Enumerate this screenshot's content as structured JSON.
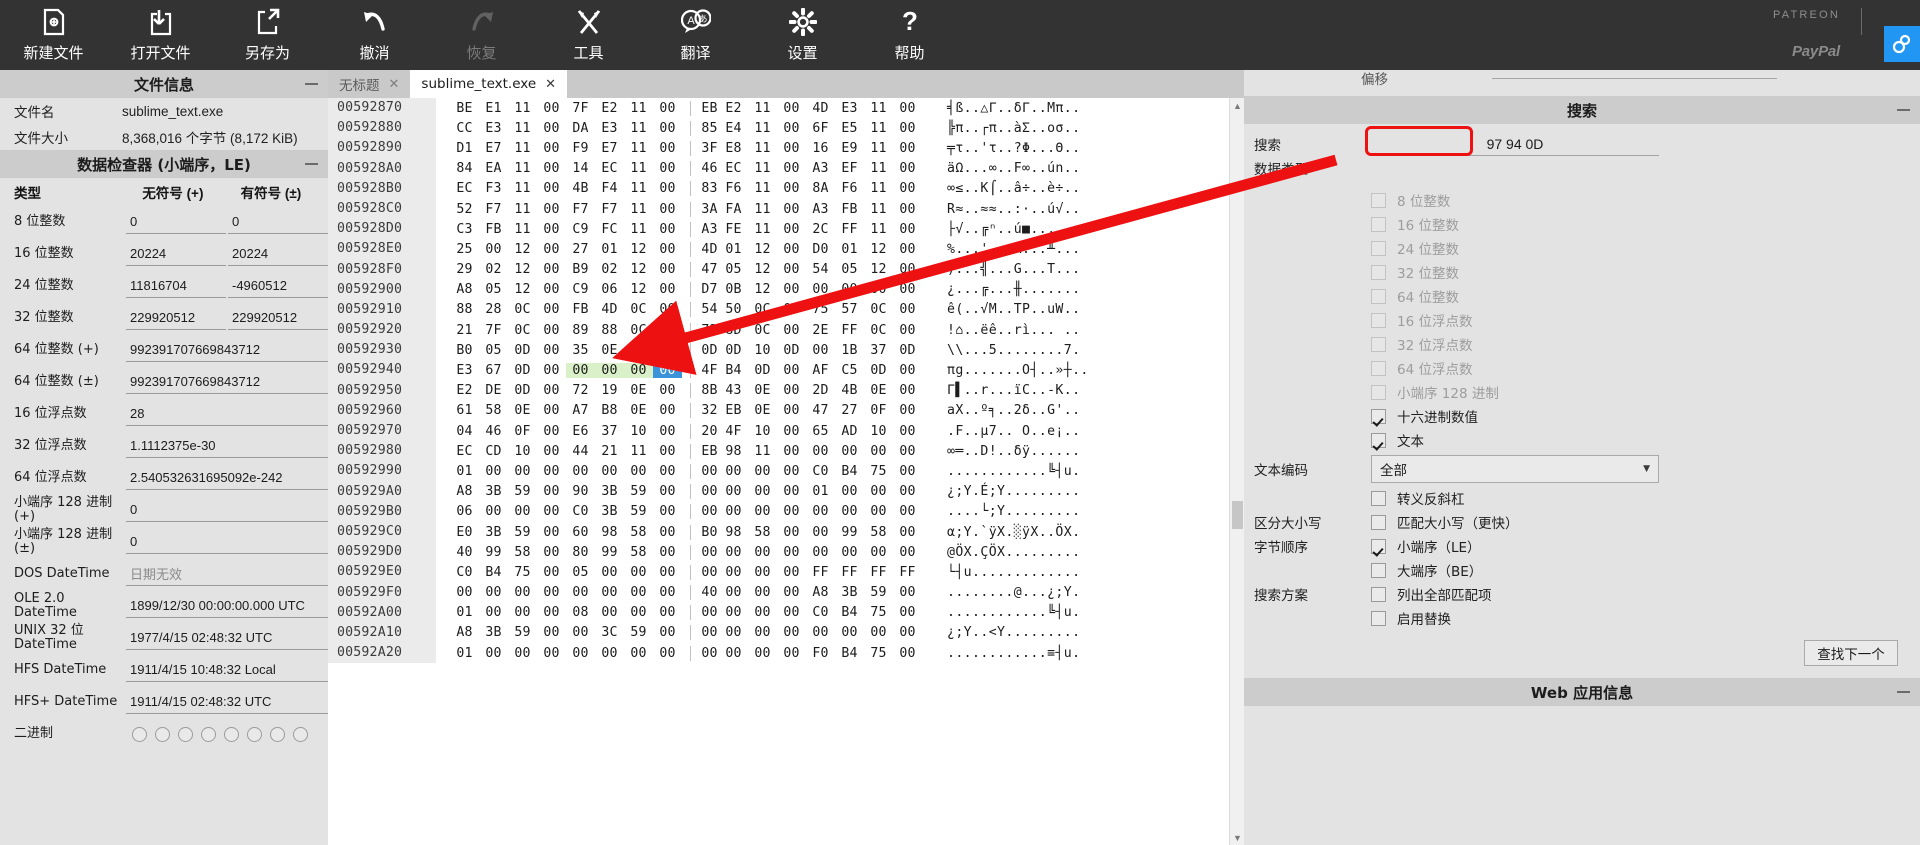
{
  "toolbar": {
    "buttons": [
      {
        "label": "新建文件",
        "icon": "new-file-icon",
        "disabled": false
      },
      {
        "label": "打开文件",
        "icon": "open-file-icon",
        "disabled": false
      },
      {
        "label": "另存为",
        "icon": "save-as-icon",
        "disabled": false
      },
      {
        "label": "撤消",
        "icon": "undo-icon",
        "disabled": false
      },
      {
        "label": "恢复",
        "icon": "redo-icon",
        "disabled": true
      },
      {
        "label": "工具",
        "icon": "tools-icon",
        "disabled": false
      },
      {
        "label": "翻译",
        "icon": "translate-icon",
        "disabled": false
      },
      {
        "label": "设置",
        "icon": "settings-icon",
        "disabled": false
      },
      {
        "label": "帮助",
        "icon": "help-icon",
        "disabled": false
      }
    ],
    "brand_patreon": "PATREON",
    "brand_paypal": "PayPal"
  },
  "sidebar": {
    "file_info": {
      "title": "文件信息",
      "rows": [
        {
          "key": "文件名",
          "value": "sublime_text.exe"
        },
        {
          "key": "文件大小",
          "value": "8,368,016 个字节 (8,172 KiB)"
        }
      ]
    },
    "data_inspector": {
      "title": "数据检查器 (小端序，LE)",
      "headers": {
        "type": "类型",
        "unsigned": "无符号 (+)",
        "signed": "有符号 (±)"
      },
      "rows": [
        {
          "label": "8 位整数",
          "unsigned": "0",
          "signed": "0",
          "wide": false,
          "grey": false
        },
        {
          "label": "16 位整数",
          "unsigned": "20224",
          "signed": "20224",
          "wide": false,
          "grey": false
        },
        {
          "label": "24 位整数",
          "unsigned": "11816704",
          "signed": "-4960512",
          "wide": false,
          "grey": false
        },
        {
          "label": "32 位整数",
          "unsigned": "229920512",
          "signed": "229920512",
          "wide": false,
          "grey": false
        },
        {
          "label": "64 位整数 (+)",
          "unsigned": "992391707669843712",
          "signed": "",
          "wide": true,
          "grey": false
        },
        {
          "label": "64 位整数 (±)",
          "unsigned": "992391707669843712",
          "signed": "",
          "wide": true,
          "grey": false
        },
        {
          "label": "16 位浮点数",
          "unsigned": "28",
          "signed": "",
          "wide": true,
          "grey": false
        },
        {
          "label": "32 位浮点数",
          "unsigned": "1.1112375e-30",
          "signed": "",
          "wide": true,
          "grey": false
        },
        {
          "label": "64 位浮点数",
          "unsigned": "2.540532631695092e-242",
          "signed": "",
          "wide": true,
          "grey": false
        },
        {
          "label": "小端序 128 进制 (+)",
          "unsigned": "0",
          "signed": "",
          "wide": true,
          "grey": false
        },
        {
          "label": "小端序 128 进制 (±)",
          "unsigned": "0",
          "signed": "",
          "wide": true,
          "grey": false
        },
        {
          "label": "DOS DateTime",
          "unsigned": "日期无效",
          "signed": "",
          "wide": true,
          "grey": true
        },
        {
          "label": "OLE 2.0 DateTime",
          "unsigned": "1899/12/30 00:00:00.000 UTC",
          "signed": "",
          "wide": true,
          "grey": false
        },
        {
          "label": "UNIX 32 位 DateTime",
          "unsigned": "1977/4/15 02:48:32 UTC",
          "signed": "",
          "wide": true,
          "grey": false
        },
        {
          "label": "HFS DateTime",
          "unsigned": "1911/4/15 10:48:32 Local",
          "signed": "",
          "wide": true,
          "grey": false
        },
        {
          "label": "HFS+ DateTime",
          "unsigned": "1911/4/15 02:48:32 UTC",
          "signed": "",
          "wide": true,
          "grey": false
        }
      ],
      "binary_label": "二进制",
      "binary_bits": 8
    }
  },
  "editor": {
    "tabs": [
      {
        "label": "无标题",
        "active": false,
        "close": "✕"
      },
      {
        "label": "sublime_text.exe",
        "active": true,
        "close": "✕"
      }
    ],
    "rows": [
      {
        "addr": "00592870",
        "bytes": [
          "BE",
          "E1",
          "11",
          "00",
          "7F",
          "E2",
          "11",
          "00",
          "EB",
          "E2",
          "11",
          "00",
          "4D",
          "E3",
          "11",
          "00"
        ],
        "ascii": "╡ß..△Γ..δΓ..Mπ.."
      },
      {
        "addr": "00592880",
        "bytes": [
          "CC",
          "E3",
          "11",
          "00",
          "DA",
          "E3",
          "11",
          "00",
          "85",
          "E4",
          "11",
          "00",
          "6F",
          "E5",
          "11",
          "00"
        ],
        "ascii": "╠π..┌π..àΣ..oσ.."
      },
      {
        "addr": "00592890",
        "bytes": [
          "D1",
          "E7",
          "11",
          "00",
          "F9",
          "E7",
          "11",
          "00",
          "3F",
          "E8",
          "11",
          "00",
          "16",
          "E9",
          "11",
          "00"
        ],
        "ascii": "╤τ..'τ..?Φ...Θ.."
      },
      {
        "addr": "005928A0",
        "bytes": [
          "84",
          "EA",
          "11",
          "00",
          "14",
          "EC",
          "11",
          "00",
          "46",
          "EC",
          "11",
          "00",
          "A3",
          "EF",
          "11",
          "00"
        ],
        "ascii": "äΩ...∞..F∞..ún.."
      },
      {
        "addr": "005928B0",
        "bytes": [
          "EC",
          "F3",
          "11",
          "00",
          "4B",
          "F4",
          "11",
          "00",
          "83",
          "F6",
          "11",
          "00",
          "8A",
          "F6",
          "11",
          "00"
        ],
        "ascii": "∞≤..K⌠..â÷..è÷.."
      },
      {
        "addr": "005928C0",
        "bytes": [
          "52",
          "F7",
          "11",
          "00",
          "F7",
          "F7",
          "11",
          "00",
          "3A",
          "FA",
          "11",
          "00",
          "A3",
          "FB",
          "11",
          "00"
        ],
        "ascii": "R≈..≈≈..:·..ú√.."
      },
      {
        "addr": "005928D0",
        "bytes": [
          "C3",
          "FB",
          "11",
          "00",
          "C9",
          "FC",
          "11",
          "00",
          "A3",
          "FE",
          "11",
          "00",
          "2C",
          "FF",
          "11",
          "00"
        ],
        "ascii": "├√..╔ⁿ..ú■..,  ."
      },
      {
        "addr": "005928E0",
        "bytes": [
          "25",
          "00",
          "12",
          "00",
          "27",
          "01",
          "12",
          "00",
          "4D",
          "01",
          "12",
          "00",
          "D0",
          "01",
          "12",
          "00"
        ],
        "ascii": "%...'...M...╨..."
      },
      {
        "addr": "005928F0",
        "bytes": [
          "29",
          "02",
          "12",
          "00",
          "B9",
          "02",
          "12",
          "00",
          "47",
          "05",
          "12",
          "00",
          "54",
          "05",
          "12",
          "00"
        ],
        "ascii": ")...╣...G...T..."
      },
      {
        "addr": "00592900",
        "bytes": [
          "A8",
          "05",
          "12",
          "00",
          "C9",
          "06",
          "12",
          "00",
          "D7",
          "0B",
          "12",
          "00",
          "00",
          "00",
          "00",
          "00"
        ],
        "ascii": "¿...╔...╫......."
      },
      {
        "addr": "00592910",
        "bytes": [
          "88",
          "28",
          "0C",
          "00",
          "FB",
          "4D",
          "0C",
          "00",
          "54",
          "50",
          "0C",
          "00",
          "75",
          "57",
          "0C",
          "00"
        ],
        "ascii": "ê(..√M..TP..uW.."
      },
      {
        "addr": "00592920",
        "bytes": [
          "21",
          "7F",
          "0C",
          "00",
          "89",
          "88",
          "0C",
          "00",
          "72",
          "8D",
          "0C",
          "00",
          "2E",
          "FF",
          "0C",
          "00"
        ],
        "ascii": "!⌂..ëê..rì... .."
      },
      {
        "addr": "00592930",
        "bytes": [
          "B0",
          "05",
          "0D",
          "00",
          "35",
          "0E",
          "0D",
          "00",
          "0D",
          "0D",
          "10",
          "0D",
          "00",
          "1B",
          "37",
          "0D"
        ],
        "ascii": "\\\\...5........7."
      },
      {
        "addr": "00592940",
        "bytes": [
          "E3",
          "67",
          "0D",
          "00",
          "00",
          "00",
          "00",
          "00",
          "4F",
          "B4",
          "0D",
          "00",
          "AF",
          "C5",
          "0D",
          "00"
        ],
        "ascii": "πg.......O┤..»┼..",
        "highlight": [
          4,
          5,
          6
        ],
        "selected": 7
      },
      {
        "addr": "00592950",
        "bytes": [
          "E2",
          "DE",
          "0D",
          "00",
          "72",
          "19",
          "0E",
          "00",
          "8B",
          "43",
          "0E",
          "00",
          "2D",
          "4B",
          "0E",
          "00"
        ],
        "ascii": "Γ▌..r...ïC..-K.."
      },
      {
        "addr": "00592960",
        "bytes": [
          "61",
          "58",
          "0E",
          "00",
          "A7",
          "B8",
          "0E",
          "00",
          "32",
          "EB",
          "0E",
          "00",
          "47",
          "27",
          "0F",
          "00"
        ],
        "ascii": "aX..º╕..2δ..G'.."
      },
      {
        "addr": "00592970",
        "bytes": [
          "04",
          "46",
          "0F",
          "00",
          "E6",
          "37",
          "10",
          "00",
          "20",
          "4F",
          "10",
          "00",
          "65",
          "AD",
          "10",
          "00"
        ],
        "ascii": ".F..µ7.. O..e¡.."
      },
      {
        "addr": "00592980",
        "bytes": [
          "EC",
          "CD",
          "10",
          "00",
          "44",
          "21",
          "11",
          "00",
          "EB",
          "98",
          "11",
          "00",
          "00",
          "00",
          "00",
          "00"
        ],
        "ascii": "∞═..D!..δÿ......"
      },
      {
        "addr": "00592990",
        "bytes": [
          "01",
          "00",
          "00",
          "00",
          "00",
          "00",
          "00",
          "00",
          "00",
          "00",
          "00",
          "00",
          "C0",
          "B4",
          "75",
          "00"
        ],
        "ascii": "............╚┤u."
      },
      {
        "addr": "005929A0",
        "bytes": [
          "A8",
          "3B",
          "59",
          "00",
          "90",
          "3B",
          "59",
          "00",
          "00",
          "00",
          "00",
          "00",
          "01",
          "00",
          "00",
          "00"
        ],
        "ascii": "¿;Y.É;Y........."
      },
      {
        "addr": "005929B0",
        "bytes": [
          "06",
          "00",
          "00",
          "00",
          "C0",
          "3B",
          "59",
          "00",
          "00",
          "00",
          "00",
          "00",
          "00",
          "00",
          "00",
          "00"
        ],
        "ascii": "....└;Y........."
      },
      {
        "addr": "005929C0",
        "bytes": [
          "E0",
          "3B",
          "59",
          "00",
          "60",
          "98",
          "58",
          "00",
          "B0",
          "98",
          "58",
          "00",
          "00",
          "99",
          "58",
          "00"
        ],
        "ascii": "α;Y.`ÿX.░ÿX..ÖX."
      },
      {
        "addr": "005929D0",
        "bytes": [
          "40",
          "99",
          "58",
          "00",
          "80",
          "99",
          "58",
          "00",
          "00",
          "00",
          "00",
          "00",
          "00",
          "00",
          "00",
          "00"
        ],
        "ascii": "@ÖX.ÇÖX........."
      },
      {
        "addr": "005929E0",
        "bytes": [
          "C0",
          "B4",
          "75",
          "00",
          "05",
          "00",
          "00",
          "00",
          "00",
          "00",
          "00",
          "00",
          "FF",
          "FF",
          "FF",
          "FF"
        ],
        "ascii": "└┤u............."
      },
      {
        "addr": "005929F0",
        "bytes": [
          "00",
          "00",
          "00",
          "00",
          "00",
          "00",
          "00",
          "00",
          "40",
          "00",
          "00",
          "00",
          "A8",
          "3B",
          "59",
          "00"
        ],
        "ascii": "........@...¿;Y."
      },
      {
        "addr": "00592A00",
        "bytes": [
          "01",
          "00",
          "00",
          "00",
          "08",
          "00",
          "00",
          "00",
          "00",
          "00",
          "00",
          "00",
          "C0",
          "B4",
          "75",
          "00"
        ],
        "ascii": "............╚┤u."
      },
      {
        "addr": "00592A10",
        "bytes": [
          "A8",
          "3B",
          "59",
          "00",
          "00",
          "3C",
          "59",
          "00",
          "00",
          "00",
          "00",
          "00",
          "00",
          "00",
          "00",
          "00"
        ],
        "ascii": "¿;Y..<Y........."
      },
      {
        "addr": "00592A20",
        "bytes": [
          "01",
          "00",
          "00",
          "00",
          "00",
          "00",
          "00",
          "00",
          "00",
          "00",
          "00",
          "00",
          "F0",
          "B4",
          "75",
          "00"
        ],
        "ascii": "............≡┤u."
      }
    ]
  },
  "search_panel": {
    "above_label": "偏移",
    "title": "搜索",
    "search_label": "搜索",
    "search_value": "97 94 0D",
    "datatype_label": "数据类型",
    "datatypes": [
      {
        "label": "8 位整数",
        "checked": false,
        "disabled": true
      },
      {
        "label": "16 位整数",
        "checked": false,
        "disabled": true
      },
      {
        "label": "24 位整数",
        "checked": false,
        "disabled": true
      },
      {
        "label": "32 位整数",
        "checked": false,
        "disabled": true
      },
      {
        "label": "64 位整数",
        "checked": false,
        "disabled": true
      },
      {
        "label": "16 位浮点数",
        "checked": false,
        "disabled": true
      },
      {
        "label": "32 位浮点数",
        "checked": false,
        "disabled": true
      },
      {
        "label": "64 位浮点数",
        "checked": false,
        "disabled": true
      },
      {
        "label": "小端序 128 进制",
        "checked": false,
        "disabled": true
      },
      {
        "label": "十六进制数值",
        "checked": true,
        "disabled": false
      },
      {
        "label": "文本",
        "checked": true,
        "disabled": false
      }
    ],
    "encoding_label": "文本编码",
    "encoding_value": "全部",
    "escape_option": {
      "label": "转义反斜杠",
      "checked": false
    },
    "case_label": "区分大小写",
    "case_option": {
      "label": "匹配大小写（更快）",
      "checked": false
    },
    "byteorder_label": "字节顺序",
    "byteorder_options": [
      {
        "label": "小端序（LE）",
        "checked": true
      },
      {
        "label": "大端序（BE）",
        "checked": false
      }
    ],
    "scheme_label": "搜索方案",
    "scheme_options": [
      {
        "label": "列出全部匹配项",
        "checked": false
      },
      {
        "label": "启用替换",
        "checked": false
      }
    ],
    "find_next_label": "查找下一个",
    "web_info_title": "Web 应用信息"
  },
  "colors": {
    "toolbar_bg": "#333333",
    "panel_bg": "#e3e3e3",
    "panel_header": "#cccccc",
    "highlight_green": "#d9f0c8",
    "selection_blue": "#3b94d9",
    "annotation_red": "#ee1111",
    "accent_blue": "#2196f3"
  }
}
